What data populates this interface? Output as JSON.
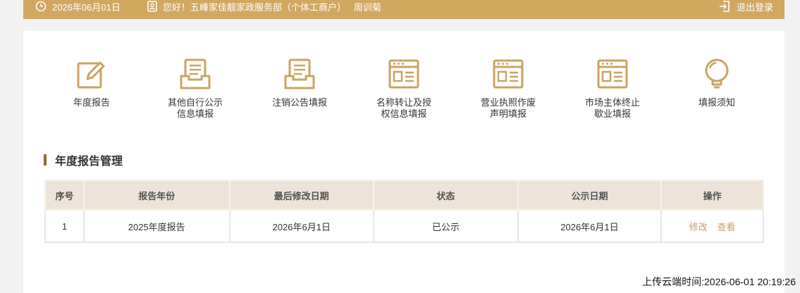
{
  "topbar": {
    "date": "2026年06月01日",
    "greeting": "您好！五峰家佳靓家政服务部（个体工商户）   周训菊",
    "logout": "退出登录",
    "icons": {
      "clock": "clock-icon",
      "user": "user-card-icon",
      "logout": "logout-icon"
    }
  },
  "nav": {
    "items": [
      {
        "label": "年度报告",
        "icon": "edit-icon"
      },
      {
        "label": "其他自行公示\n信息填报",
        "icon": "tray-document-icon"
      },
      {
        "label": "注销公告填报",
        "icon": "tray-document-icon"
      },
      {
        "label": "名称转让及授\n权信息填报",
        "icon": "browser-card-icon"
      },
      {
        "label": "营业执照作废\n声明填报",
        "icon": "browser-card-icon"
      },
      {
        "label": "市场主体终止\n歇业填报",
        "icon": "browser-card-icon"
      },
      {
        "label": "填报须知",
        "icon": "lightbulb-icon"
      }
    ]
  },
  "section": {
    "title": "年度报告管理"
  },
  "table": {
    "headers": [
      "序号",
      "报告年份",
      "最后修改日期",
      "状态",
      "公示日期",
      "操作"
    ],
    "rows": [
      {
        "index": "1",
        "year": "2025年度报告",
        "modified": "2026年6月1日",
        "status": "已公示",
        "published": "2026年6月1日",
        "actions": [
          "修改",
          "查看"
        ]
      }
    ]
  },
  "footer": {
    "upload_time": "上传云端时间:2026-06-01 20:19:26"
  },
  "colors": {
    "accent": "#d1a860",
    "icon": "#c9a460",
    "header_bg": "#ede3d8",
    "action": "#c8a36a"
  }
}
